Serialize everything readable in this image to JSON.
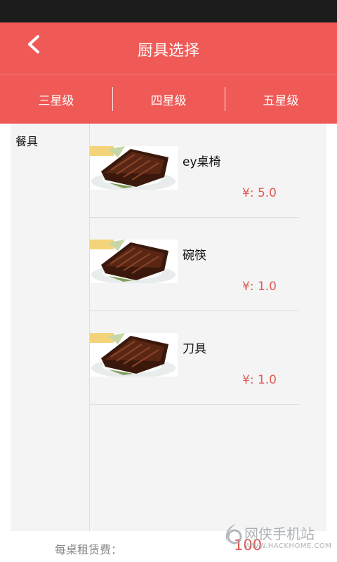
{
  "header": {
    "title": "厨具选择",
    "back_icon": "chevron-left-icon"
  },
  "tabs": [
    {
      "label": "三星级"
    },
    {
      "label": "四星级"
    },
    {
      "label": "五星级"
    }
  ],
  "sidebar": {
    "items": [
      {
        "label": "餐具"
      }
    ]
  },
  "items": [
    {
      "name": "ey桌椅",
      "price": "¥: 5.0"
    },
    {
      "name": "碗筷",
      "price": "¥: 1.0"
    },
    {
      "name": "刀具",
      "price": "¥: 1.0"
    }
  ],
  "footer": {
    "fee_label": "每桌租赁费：",
    "fee_value": "100"
  },
  "watermark": {
    "name": "网侠手机站",
    "url": "WWW.HACKHOME.COM"
  },
  "colors": {
    "accent": "#ef5a57",
    "price": "#e05a56",
    "status_bar": "#1b1b1b"
  }
}
